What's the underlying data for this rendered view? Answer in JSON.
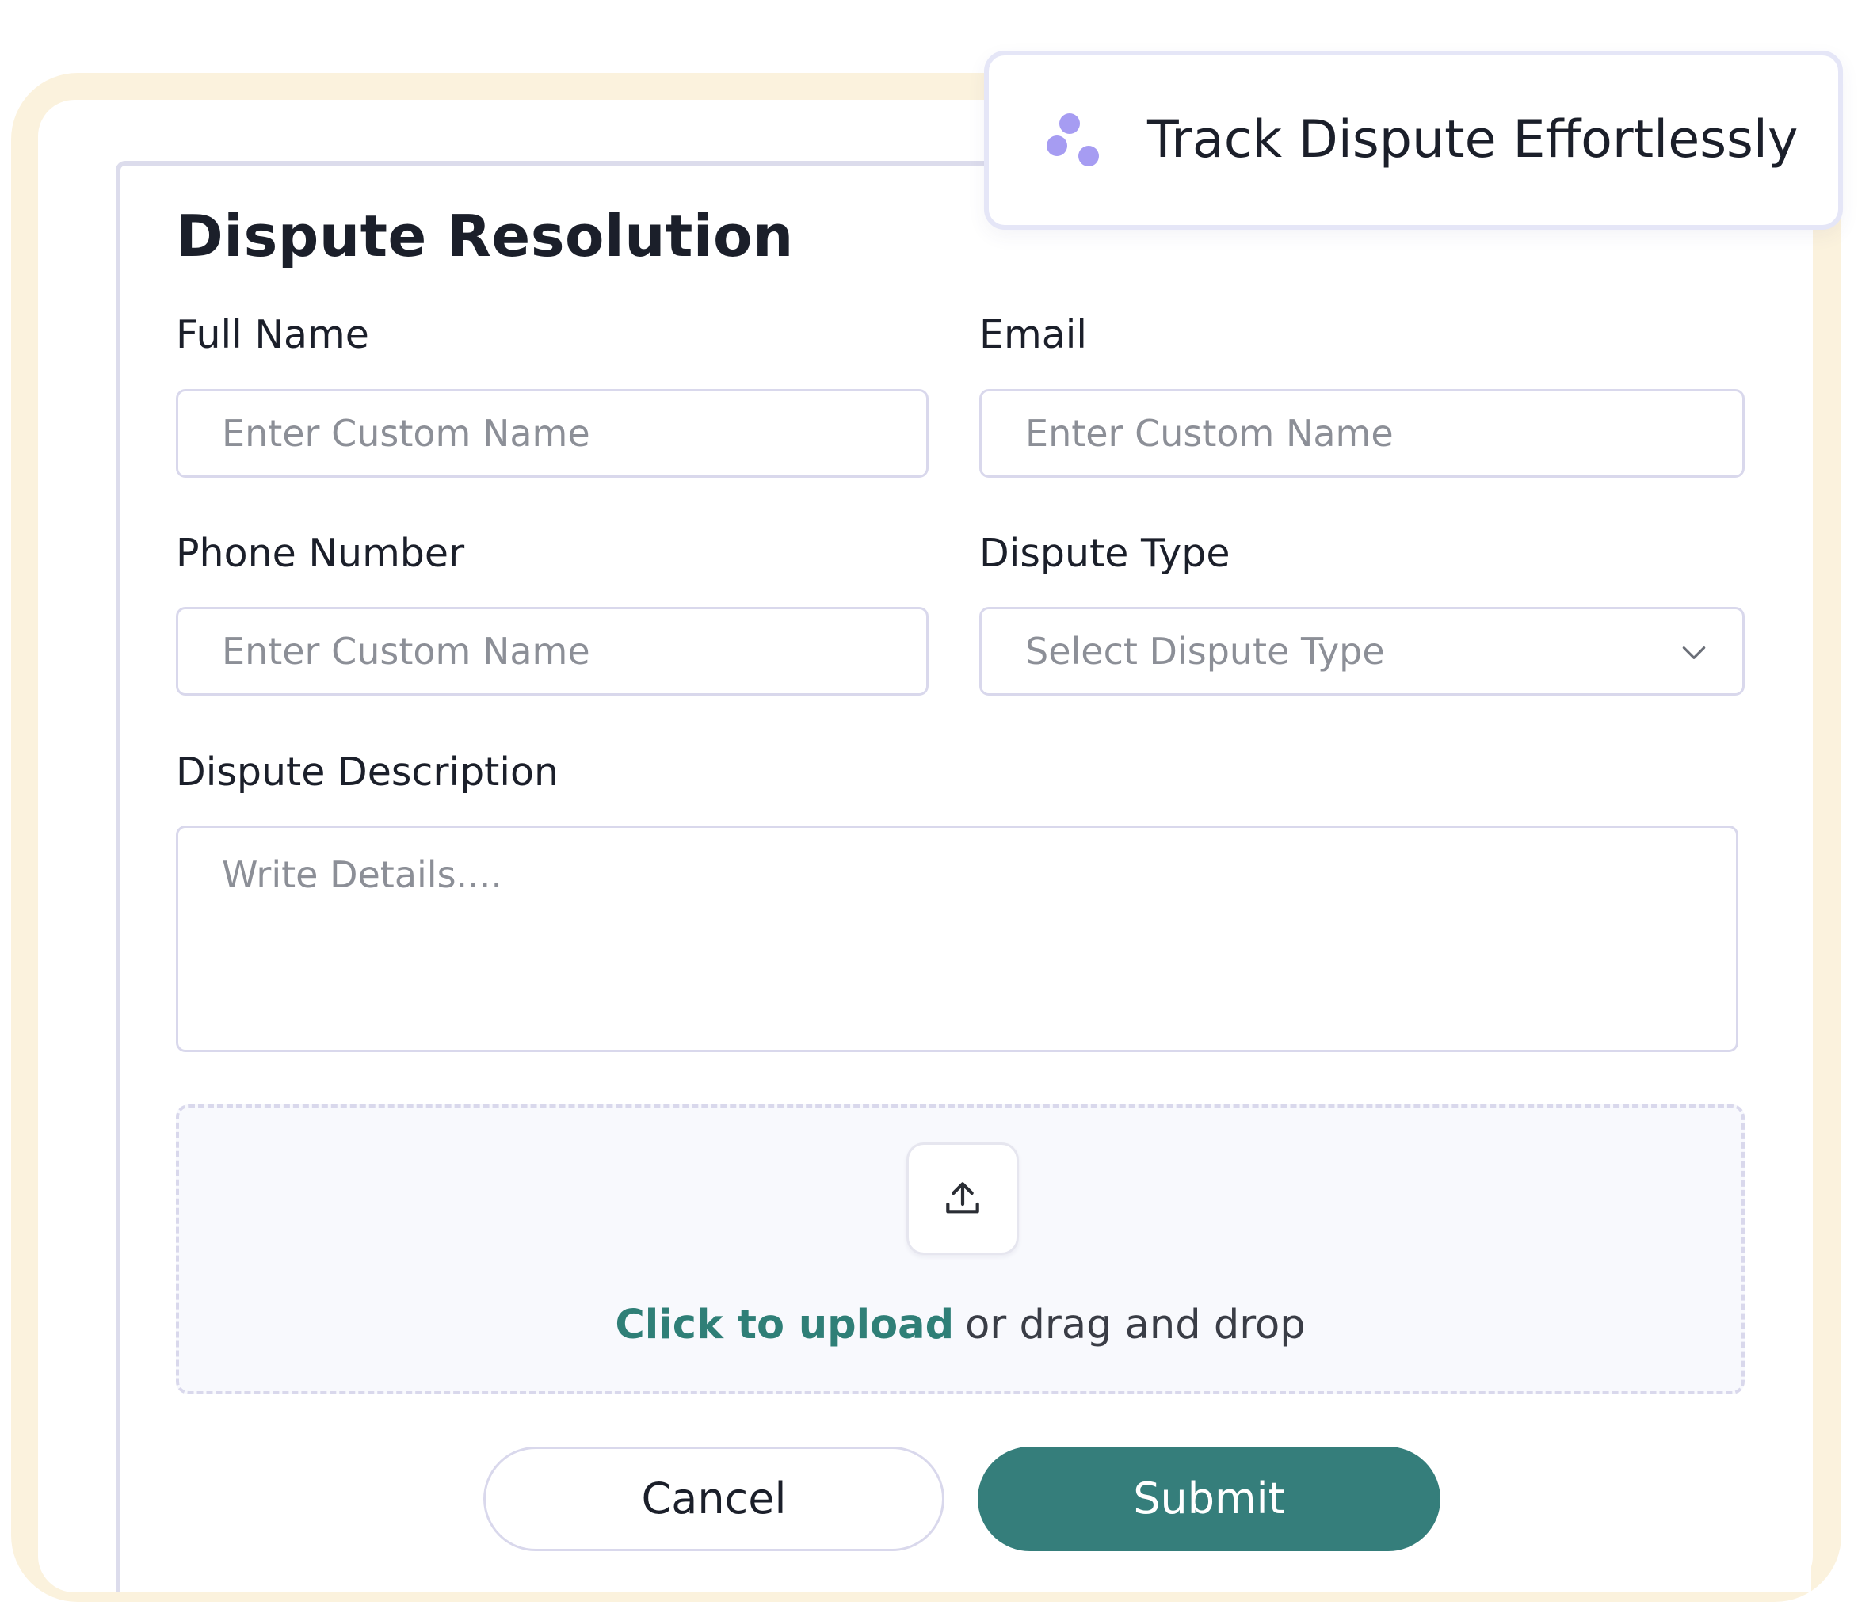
{
  "toast": {
    "icon": "three-dots-cluster-icon",
    "text": "Track Dispute Effortlessly"
  },
  "form": {
    "title": "Dispute Resolution",
    "full_name": {
      "label": "Full Name",
      "placeholder": "Enter Custom Name"
    },
    "email": {
      "label": "Email",
      "placeholder": "Enter Custom Name"
    },
    "phone": {
      "label": "Phone Number",
      "placeholder": "Enter Custom Name"
    },
    "dispute_type": {
      "label": "Dispute Type",
      "placeholder": "Select Dispute Type"
    },
    "description": {
      "label": "Dispute Description",
      "placeholder": "Write Details...."
    },
    "upload": {
      "icon": "upload-icon",
      "link_text": "Click to upload",
      "rest_text": "or drag and drop"
    },
    "buttons": {
      "cancel": "Cancel",
      "submit": "Submit"
    }
  },
  "colors": {
    "accent": "#357e7b",
    "link": "#2f7f77",
    "icon_purple": "#a69cf2",
    "frame": "#fbf2dd",
    "border": "#d9d8ec"
  }
}
